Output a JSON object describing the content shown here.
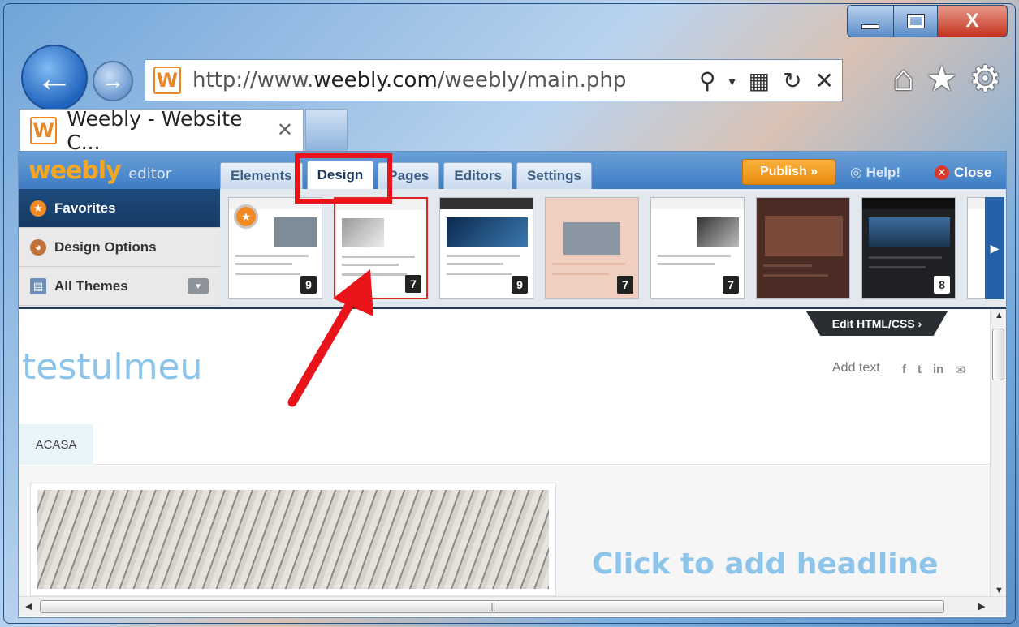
{
  "browser": {
    "url_prefix": "http://www.",
    "url_domain": "weebly.com",
    "url_path": "/weebly/main.php",
    "favicon_letter": "W",
    "tab_title": "Weebly - Website C...",
    "tab_close": "✕"
  },
  "editor": {
    "logo": "weebly",
    "logo_suffix": "editor",
    "tabs": [
      "Elements",
      "Design",
      "Pages",
      "Editors",
      "Settings"
    ],
    "active_tab": "Design",
    "publish_label": "Publish »",
    "help_label": "Help!",
    "close_label": "Close"
  },
  "design_panel": {
    "sidebar": [
      {
        "label": "Favorites"
      },
      {
        "label": "Design Options"
      },
      {
        "label": "All Themes"
      }
    ],
    "themes": [
      {
        "count": "9",
        "favorite": true
      },
      {
        "count": "7",
        "selected": true
      },
      {
        "count": "9"
      },
      {
        "count": "7"
      },
      {
        "count": "7"
      },
      {
        "count": ""
      },
      {
        "count": "8"
      },
      {
        "count": ""
      }
    ],
    "edit_html_label": "Edit HTML/CSS ›"
  },
  "site": {
    "title": "testulmeu",
    "add_text": "Add text",
    "social": [
      "f",
      "t",
      "in",
      "✉"
    ],
    "nav": [
      "ACASA"
    ],
    "headline": "Click to add headline"
  },
  "colors": {
    "annotation": "#e8141a",
    "publish": "#f39a1f",
    "accent": "#8cc4ea"
  }
}
